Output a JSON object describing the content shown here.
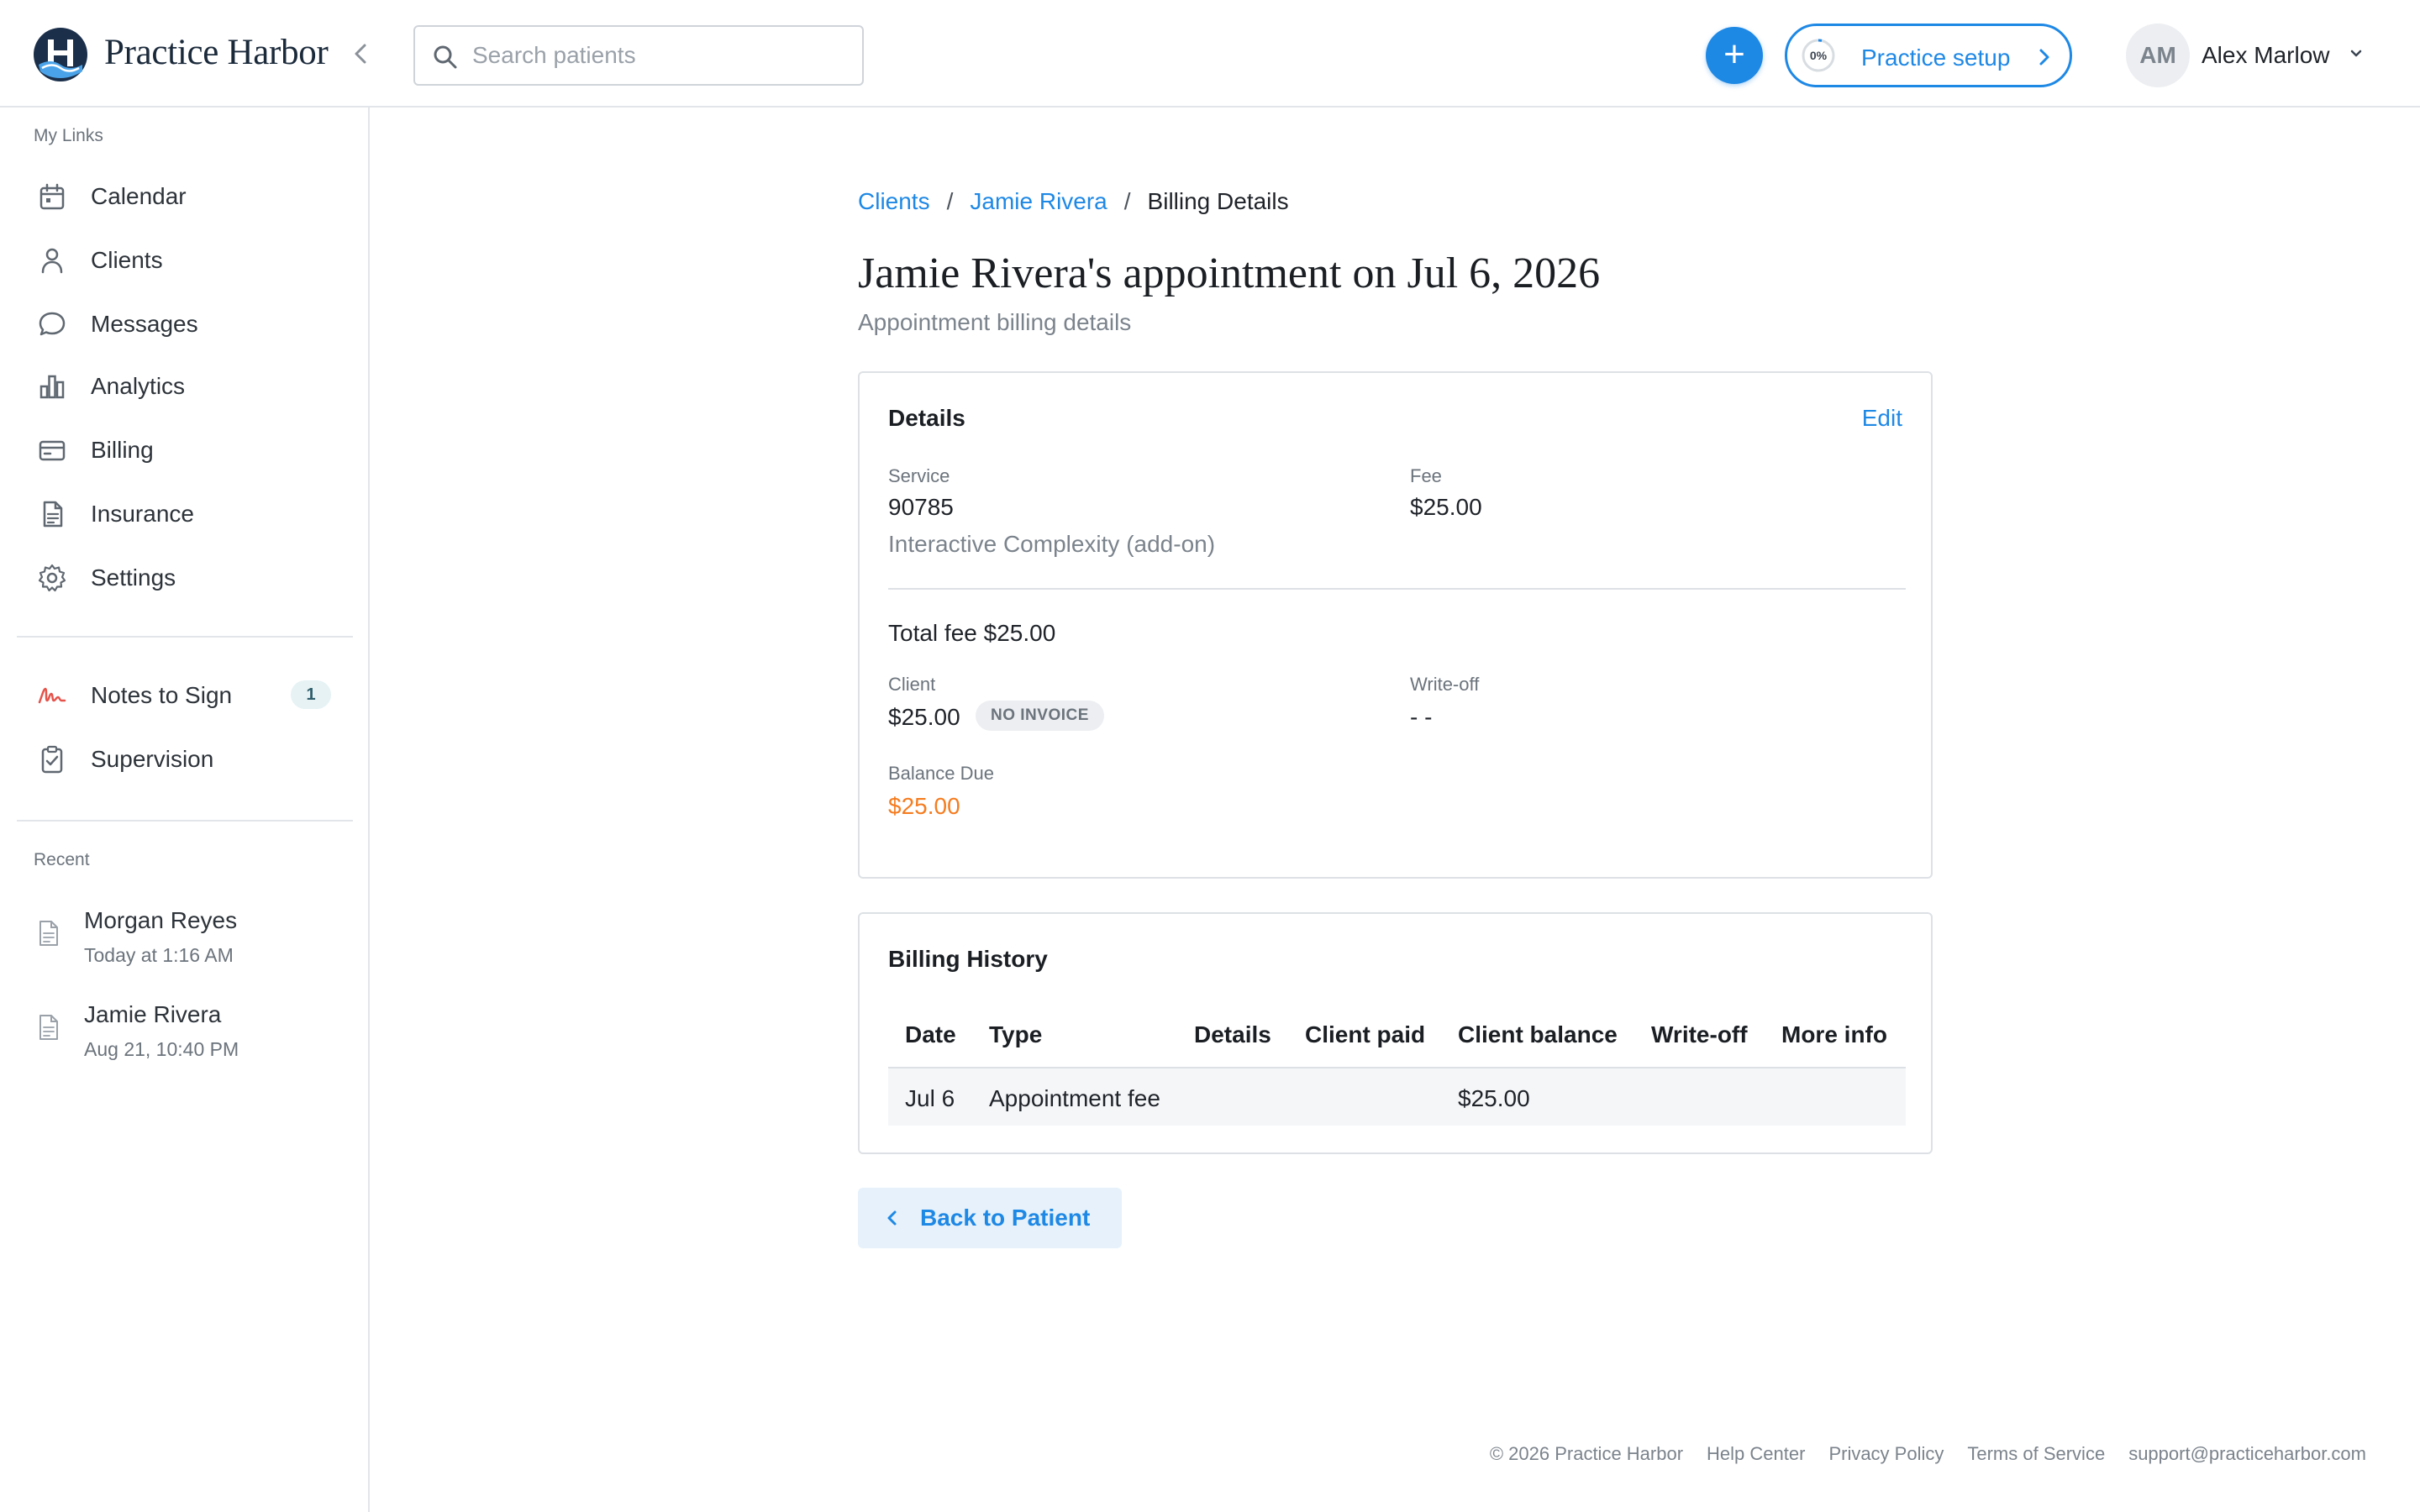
{
  "app": {
    "name": "Practice Harbor"
  },
  "search": {
    "placeholder": "Search patients"
  },
  "header": {
    "setup_progress": "0%",
    "setup_label": "Practice setup",
    "user_initials": "AM",
    "user_name": "Alex Marlow"
  },
  "sidebar": {
    "my_links_heading": "My Links",
    "items": [
      {
        "label": "Calendar",
        "icon": "calendar-icon"
      },
      {
        "label": "Clients",
        "icon": "user-icon"
      },
      {
        "label": "Messages",
        "icon": "chat-icon"
      },
      {
        "label": "Analytics",
        "icon": "bar-chart-icon"
      },
      {
        "label": "Billing",
        "icon": "credit-card-icon"
      },
      {
        "label": "Insurance",
        "icon": "document-icon"
      },
      {
        "label": "Settings",
        "icon": "gear-icon"
      }
    ],
    "secondary_items": [
      {
        "label": "Notes to Sign",
        "icon": "signature-icon",
        "badge": "1"
      },
      {
        "label": "Supervision",
        "icon": "clipboard-check-icon"
      }
    ],
    "recent_heading": "Recent",
    "recent": [
      {
        "name": "Morgan Reyes",
        "time": "Today at 1:16 AM"
      },
      {
        "name": "Jamie Rivera",
        "time": "Aug 21, 10:40 PM"
      }
    ]
  },
  "breadcrumb": {
    "items": [
      "Clients",
      "Jamie Rivera"
    ],
    "separator": "/",
    "current": "Billing Details"
  },
  "page": {
    "title": "Jamie Rivera's appointment on Jul 6, 2026",
    "subtitle": "Appointment billing details"
  },
  "details": {
    "title": "Details",
    "edit_label": "Edit",
    "service_label": "Service",
    "service_code": "90785",
    "service_desc": "Interactive Complexity (add-on)",
    "fee_label": "Fee",
    "fee_value": "$25.00",
    "total_fee": "Total fee $25.00",
    "client_label": "Client",
    "client_value": "$25.00",
    "invoice_status": "NO INVOICE",
    "writeoff_label": "Write-off",
    "writeoff_value": "- -",
    "balance_label": "Balance Due",
    "balance_value": "$25.00"
  },
  "history": {
    "title": "Billing History",
    "columns": [
      "Date",
      "Type",
      "Details",
      "Client paid",
      "Client balance",
      "Write-off",
      "More info"
    ],
    "rows": [
      {
        "date": "Jul 6",
        "type": "Appointment fee",
        "details": "",
        "client_paid": "",
        "client_balance": "$25.00",
        "write_off": "",
        "more_info": ""
      }
    ]
  },
  "back_button": {
    "label": "Back to Patient"
  },
  "footer": {
    "copyright": "© 2026 Practice Harbor",
    "links": [
      "Help Center",
      "Privacy Policy",
      "Terms of Service",
      "support@practiceharbor.com"
    ]
  },
  "colors": {
    "accent": "#1e88e5",
    "balance_due": "#f57c1f",
    "signature": "#e5534b"
  }
}
